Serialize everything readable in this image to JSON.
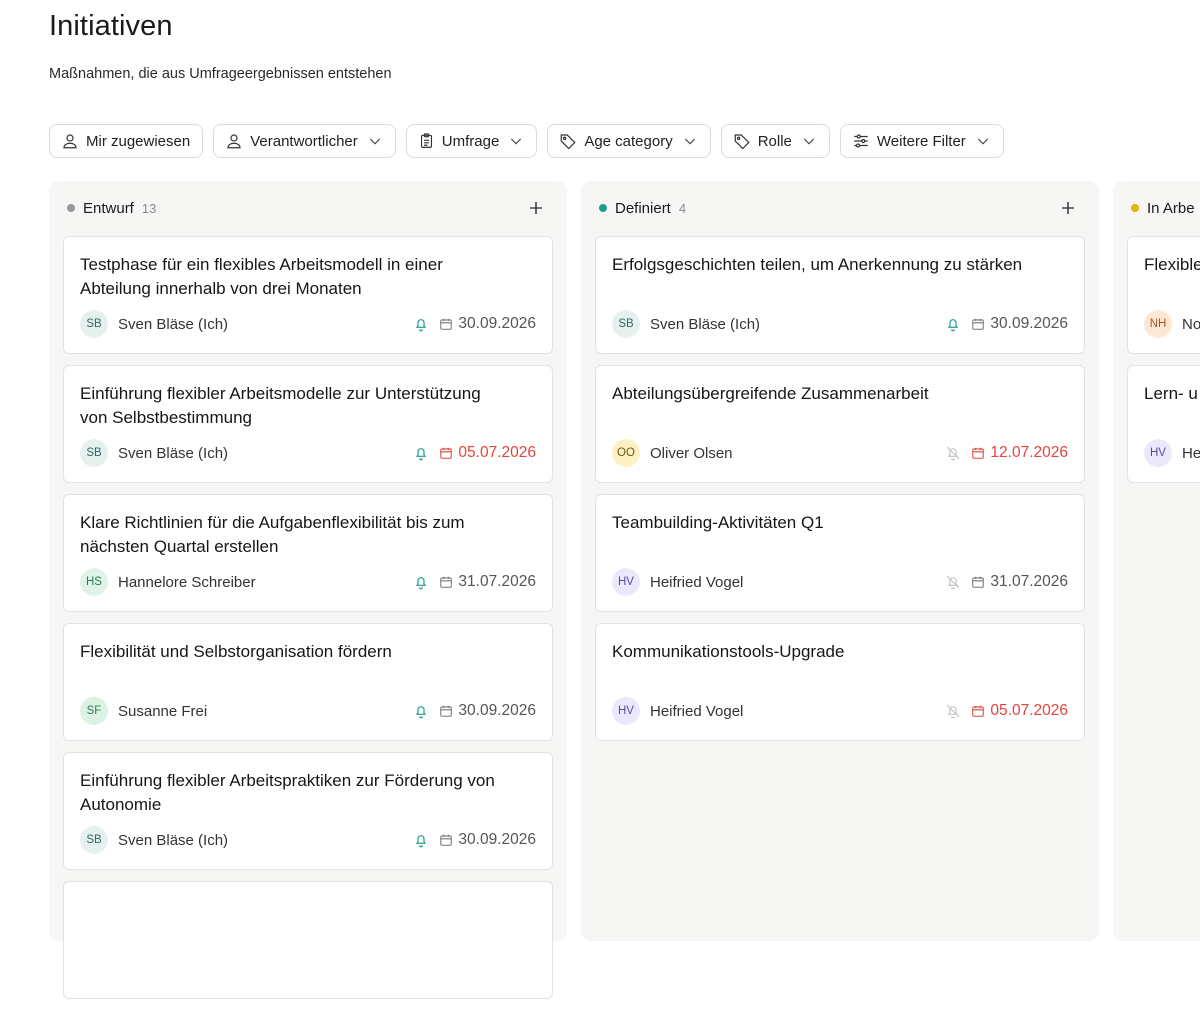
{
  "page": {
    "title": "Initiativen",
    "subtitle": "Maßnahmen, die aus Umfrageergebnissen entstehen"
  },
  "filters": [
    {
      "label": "Mir zugewiesen",
      "icon": "user-icon"
    },
    {
      "label": "Verantwortlicher",
      "icon": "user-icon"
    },
    {
      "label": "Umfrage",
      "icon": "clipboard-icon"
    },
    {
      "label": "Age category",
      "icon": "tag-icon"
    },
    {
      "label": "Rolle",
      "icon": "tag-icon"
    },
    {
      "label": "Weitere Filter",
      "icon": "sliders-icon"
    }
  ],
  "colors": {
    "draft_dot": "#9a9a9a",
    "defined_dot": "#1f9e8f",
    "in_progress_dot": "#e7b400",
    "overdue": "#e0463e",
    "avatar_sb_bg": "#e6f1ef",
    "avatar_sb_fg": "#2f6b63",
    "avatar_hs_bg": "#dff3e8",
    "avatar_hs_fg": "#2e7d54",
    "avatar_sf_bg": "#dcf3e4",
    "avatar_sf_fg": "#2e7d54",
    "avatar_oo_bg": "#fbf1c4",
    "avatar_oo_fg": "#6a5a10",
    "avatar_hv_bg": "#ece8fb",
    "avatar_hv_fg": "#5a4aa8",
    "avatar_nh_bg": "#fde7d6",
    "avatar_nh_fg": "#a35a1d"
  },
  "columns": [
    {
      "name": "Entwurf",
      "count": "13",
      "cards": [
        {
          "title": "Testphase für ein flexibles Arbeitsmodell in einer Abteilung innerhalb von drei Monaten",
          "initials": "SB",
          "person": "Sven Bläse (Ich)",
          "date": "30.09.2026",
          "overdue": false,
          "bell": "on"
        },
        {
          "title": "Einführung flexibler Arbeitsmodelle zur Unterstützung von Selbstbestimmung",
          "initials": "SB",
          "person": "Sven Bläse (Ich)",
          "date": "05.07.2026",
          "overdue": true,
          "bell": "on"
        },
        {
          "title": "Klare Richtlinien für die Aufgabenflexibilität bis zum nächsten Quartal erstellen",
          "initials": "HS",
          "person": "Hannelore Schreiber",
          "date": "31.07.2026",
          "overdue": false,
          "bell": "on"
        },
        {
          "title": "Flexibilität und Selbstorganisation fördern",
          "initials": "SF",
          "person": "Susanne Frei",
          "date": "30.09.2026",
          "overdue": false,
          "bell": "on"
        },
        {
          "title": "Einführung flexibler Arbeitspraktiken zur Förderung von Autonomie",
          "initials": "SB",
          "person": "Sven Bläse (Ich)",
          "date": "30.09.2026",
          "overdue": false,
          "bell": "on"
        }
      ]
    },
    {
      "name": "Definiert",
      "count": "4",
      "cards": [
        {
          "title": "Erfolgsgeschichten teilen, um Anerkennung zu stärken",
          "initials": "SB",
          "person": "Sven Bläse (Ich)",
          "date": "30.09.2026",
          "overdue": false,
          "bell": "on"
        },
        {
          "title": "Abteilungsübergreifende Zusammenarbeit",
          "initials": "OO",
          "person": "Oliver Olsen",
          "date": "12.07.2026",
          "overdue": true,
          "bell": "off"
        },
        {
          "title": "Teambuilding-Aktivitäten Q1",
          "initials": "HV",
          "person": "Heifried Vogel",
          "date": "31.07.2026",
          "overdue": false,
          "bell": "off"
        },
        {
          "title": "Kommunikationstools-Upgrade",
          "initials": "HV",
          "person": "Heifried Vogel",
          "date": "05.07.2026",
          "overdue": true,
          "bell": "off"
        }
      ]
    },
    {
      "name": "In Arbe",
      "cards": [
        {
          "title": "Flexible",
          "initials": "NH",
          "person": "No"
        },
        {
          "title": "Lern- u",
          "initials": "HV",
          "person": "He"
        }
      ]
    }
  ]
}
